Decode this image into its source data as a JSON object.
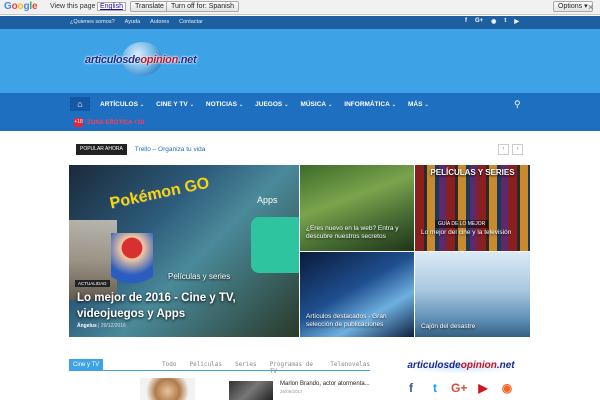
{
  "translate_bar": {
    "brand_letters": [
      "G",
      "o",
      "o",
      "g",
      "l",
      "e"
    ],
    "view_text": "View this page in:",
    "language": "English",
    "translate_btn": "Translate",
    "turn_off_btn": "Turn off for: Spanish",
    "options_btn": "Options ▾",
    "close": "×"
  },
  "topbar": {
    "links": [
      "¿Quienes somos?",
      "Ayuda",
      "Autores",
      "Contactar"
    ],
    "social_icons": [
      {
        "name": "facebook-icon",
        "glyph": "f"
      },
      {
        "name": "google-plus-icon",
        "glyph": "G+"
      },
      {
        "name": "rss-icon",
        "glyph": "◉"
      },
      {
        "name": "twitter-icon",
        "glyph": "t"
      },
      {
        "name": "youtube-icon",
        "glyph": "▶"
      }
    ]
  },
  "header": {
    "logo_main": "articulosde",
    "logo_accent": "opinion",
    "logo_tld": ".net"
  },
  "menu": {
    "home_glyph": "⌂",
    "items": [
      "ARTÍCULOS",
      "CINE Y TV",
      "NOTICIAS",
      "JUEGOS",
      "MÚSICA",
      "INFORMÁTICA",
      "MÁS"
    ],
    "chevron": "⌄",
    "search_glyph": "⚲",
    "zone_icon": "+18",
    "zone_label": "ZONA EROTICA +18"
  },
  "trending": {
    "badge": "POPULAR AHORA",
    "text": "Trello – Organiza tu vida",
    "prev": "‹",
    "next": "›"
  },
  "featured": {
    "pokemon": "Pokémon GO",
    "apps": "Apps",
    "series_label": "Películas y series",
    "category": "ACTUALIDAD",
    "title": "Lo mejor de 2016 - Cine y TV, videojuegos y Apps",
    "author": "Ángelus",
    "date": "29/12/2016"
  },
  "tiles": [
    {
      "caption": "¿Eres nuevo en la web? Entra y descubre nuestros secretos"
    },
    {
      "banner": "PELÍCULAS Y SERIES",
      "sub": "GUÍA DE LO MEJOR",
      "caption": "Lo mejor del cine y la televisión"
    },
    {
      "caption": "Artículos destacados - Gran selección de publicaciones"
    },
    {
      "caption": "Cajón del desastre"
    }
  ],
  "section": {
    "label": "Cine y TV",
    "tabs": [
      "Todo",
      "Películas",
      "Series",
      "Programas de TV",
      "Telenovelas"
    ],
    "post_title": "Marlon Brando, actor atormenta...",
    "post_date": "26/06/2017"
  },
  "sidebar": {
    "logo_main": "articulosde",
    "logo_accent": "opinion",
    "logo_tld": ".net",
    "social": [
      {
        "name": "facebook-icon",
        "glyph": "f",
        "color": "#3b5998"
      },
      {
        "name": "twitter-icon",
        "glyph": "t",
        "color": "#1da1f2"
      },
      {
        "name": "google-plus-icon",
        "glyph": "G+",
        "color": "#dd4b39"
      },
      {
        "name": "youtube-icon",
        "glyph": "▶",
        "color": "#cc181e"
      },
      {
        "name": "rss-icon",
        "glyph": "◉",
        "color": "#f26522"
      }
    ]
  },
  "colors": {
    "header_blue": "#3ea3e6",
    "menu_blue": "#1e6fbf",
    "topbar_blue": "#1e5f9f",
    "accent_red": "#c4162a"
  }
}
